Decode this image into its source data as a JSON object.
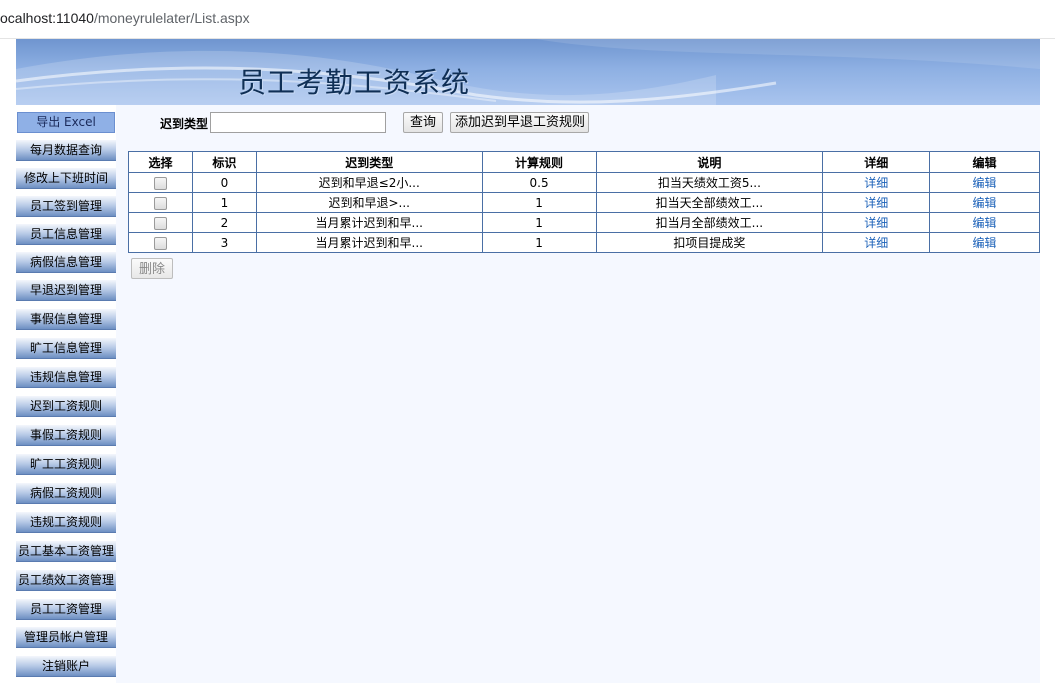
{
  "browser": {
    "url_host": "ocalhost:11040",
    "url_path": "/moneyrulelater/List.aspx"
  },
  "banner": {
    "title": "员工考勤工资系统"
  },
  "sidebar": {
    "export_label": "导出 Excel",
    "items": [
      "每月数据查询",
      "修改上下班时间",
      "员工签到管理",
      "员工信息管理",
      "病假信息管理",
      "早退迟到管理",
      "事假信息管理",
      "旷工信息管理",
      "违规信息管理",
      "迟到工资规则",
      "事假工资规则",
      "旷工工资规则",
      "病假工资规则",
      "违规工资规则",
      "员工基本工资管理",
      "员工绩效工资管理",
      "员工工资管理",
      "管理员帐户管理",
      "注销账户"
    ]
  },
  "search": {
    "label": "迟到类型",
    "value": "",
    "query_label": "查询",
    "add_label": "添加迟到早退工资规则"
  },
  "table": {
    "headers": [
      "选择",
      "标识",
      "迟到类型",
      "计算规则",
      "说明",
      "详细",
      "编辑"
    ],
    "rows": [
      {
        "id": "0",
        "type": "迟到和早退≤2小...",
        "rule": "0.5",
        "desc": "扣当天绩效工资5...",
        "detail": "详细",
        "edit": "编辑"
      },
      {
        "id": "1",
        "type": "迟到和早退>...",
        "rule": "1",
        "desc": "扣当天全部绩效工...",
        "detail": "详细",
        "edit": "编辑"
      },
      {
        "id": "2",
        "type": "当月累计迟到和早...",
        "rule": "1",
        "desc": "扣当月全部绩效工...",
        "detail": "详细",
        "edit": "编辑"
      },
      {
        "id": "3",
        "type": "当月累计迟到和早...",
        "rule": "1",
        "desc": "扣项目提成奖",
        "detail": "详细",
        "edit": "编辑"
      }
    ]
  },
  "delete_label": "删除"
}
